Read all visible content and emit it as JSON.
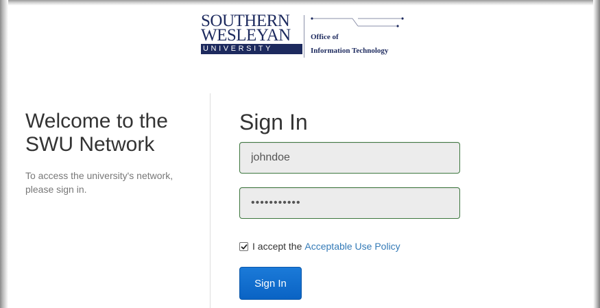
{
  "logo": {
    "line1": "SOUTHERN",
    "line2": "WESLEYAN",
    "bar": "UNIVERSITY",
    "office": "Office of",
    "department": "Information Technology"
  },
  "welcome": {
    "title_line1": "Welcome to the",
    "title_line2": "SWU Network",
    "text": "To access the university's network, please sign in."
  },
  "signin": {
    "title": "Sign In",
    "username_value": "johndoe",
    "password_value": "•••••••••••",
    "accept_prefix": "I accept the",
    "accept_link": "Acceptable Use Policy",
    "accepted": true,
    "button_label": "Sign In"
  },
  "colors": {
    "brand_navy": "#1d2a5e",
    "button_blue": "#0c6bd1",
    "link_blue": "#337ab7",
    "field_border_success": "#3c763d"
  }
}
